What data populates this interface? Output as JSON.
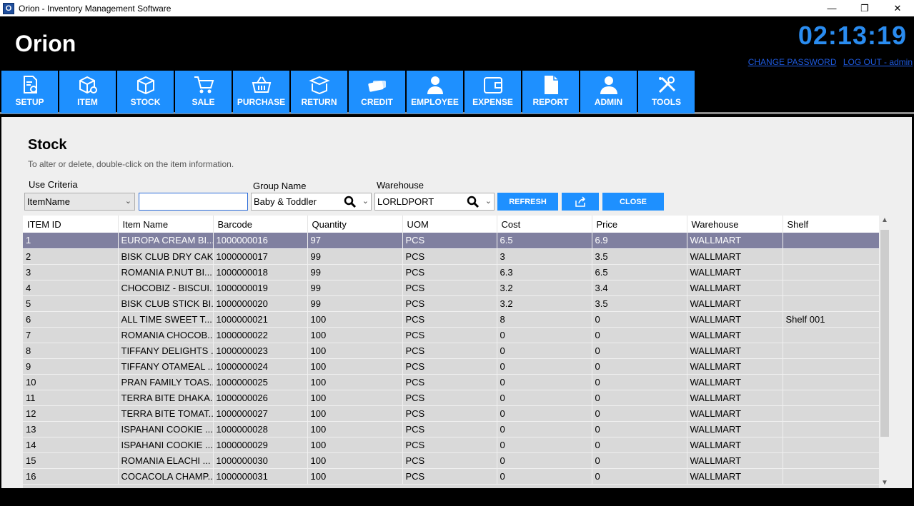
{
  "window": {
    "title": "Orion - Inventory Management Software",
    "app_icon": "O",
    "minimize": "—",
    "restore": "❐",
    "close": "✕"
  },
  "header": {
    "brand": "Orion",
    "clock": "02:13:19",
    "change_password": "CHANGE PASSWORD",
    "logout": "LOG OUT - admin",
    "clock_color": "#2a8cf0"
  },
  "menu": [
    {
      "label": "SETUP",
      "icon": "settings-doc-icon"
    },
    {
      "label": "ITEM",
      "icon": "box-gear-icon"
    },
    {
      "label": "STOCK",
      "icon": "box-icon"
    },
    {
      "label": "SALE",
      "icon": "cart-icon"
    },
    {
      "label": "PURCHASE",
      "icon": "basket-icon"
    },
    {
      "label": "RETURN",
      "icon": "open-box-icon"
    },
    {
      "label": "CREDIT",
      "icon": "credit-card-icon"
    },
    {
      "label": "EMPLOYEE",
      "icon": "employee-icon"
    },
    {
      "label": "EXPENSE",
      "icon": "wallet-icon"
    },
    {
      "label": "REPORT",
      "icon": "document-icon"
    },
    {
      "label": "ADMIN",
      "icon": "user-icon"
    },
    {
      "label": "TOOLS",
      "icon": "tools-icon"
    }
  ],
  "page": {
    "title": "Stock",
    "hint": "To alter or delete, double-click on the item information."
  },
  "filters": {
    "criteria_label": "Use Criteria",
    "criteria_value": "ItemName",
    "search_value": "",
    "group_label": "Group Name",
    "group_value": "Baby & Toddler",
    "warehouse_label": "Warehouse",
    "warehouse_value": "LORLDPORT"
  },
  "actions": {
    "refresh": "REFRESH",
    "export_icon": "share-icon",
    "close": "CLOSE"
  },
  "table": {
    "columns": [
      "ITEM ID",
      "Item Name",
      "Barcode",
      "Quantity",
      "UOM",
      "Cost",
      "Price",
      "Warehouse",
      "Shelf"
    ],
    "rows": [
      [
        "1",
        "EUROPA CREAM BI...",
        "1000000016",
        "97",
        "PCS",
        "6.5",
        "6.9",
        "WALLMART",
        ""
      ],
      [
        "2",
        "BISK CLUB DRY CAK...",
        "1000000017",
        "99",
        "PCS",
        "3",
        "3.5",
        "WALLMART",
        ""
      ],
      [
        "3",
        "ROMANIA P.NUT BI...",
        "1000000018",
        "99",
        "PCS",
        "6.3",
        "6.5",
        "WALLMART",
        ""
      ],
      [
        "4",
        "CHOCOBIZ - BISCUI...",
        "1000000019",
        "99",
        "PCS",
        "3.2",
        "3.4",
        "WALLMART",
        ""
      ],
      [
        "5",
        "BISK CLUB STICK BI...",
        "1000000020",
        "99",
        "PCS",
        "3.2",
        "3.5",
        "WALLMART",
        ""
      ],
      [
        "6",
        "ALL TIME SWEET T...",
        "1000000021",
        "100",
        "PCS",
        "8",
        "0",
        "WALLMART",
        "Shelf 001"
      ],
      [
        "7",
        "ROMANIA CHOCOB...",
        "1000000022",
        "100",
        "PCS",
        "0",
        "0",
        "WALLMART",
        ""
      ],
      [
        "8",
        "TIFFANY DELIGHTS ...",
        "1000000023",
        "100",
        "PCS",
        "0",
        "0",
        "WALLMART",
        ""
      ],
      [
        "9",
        "TIFFANY OTAMEAL ...",
        "1000000024",
        "100",
        "PCS",
        "0",
        "0",
        "WALLMART",
        ""
      ],
      [
        "10",
        "PRAN FAMILY TOAS...",
        "1000000025",
        "100",
        "PCS",
        "0",
        "0",
        "WALLMART",
        ""
      ],
      [
        "11",
        "TERRA BITE DHAKA...",
        "1000000026",
        "100",
        "PCS",
        "0",
        "0",
        "WALLMART",
        ""
      ],
      [
        "12",
        "TERRA BITE TOMAT...",
        "1000000027",
        "100",
        "PCS",
        "0",
        "0",
        "WALLMART",
        ""
      ],
      [
        "13",
        "ISPAHANI COOKIE ...",
        "1000000028",
        "100",
        "PCS",
        "0",
        "0",
        "WALLMART",
        ""
      ],
      [
        "14",
        "ISPAHANI COOKIE ...",
        "1000000029",
        "100",
        "PCS",
        "0",
        "0",
        "WALLMART",
        ""
      ],
      [
        "15",
        "ROMANIA ELACHI ...",
        "1000000030",
        "100",
        "PCS",
        "0",
        "0",
        "WALLMART",
        ""
      ],
      [
        "16",
        "COCACOLA CHAMP...",
        "1000000031",
        "100",
        "PCS",
        "0",
        "0",
        "WALLMART",
        ""
      ]
    ]
  },
  "colors": {
    "menu_button": "#1e90ff",
    "selected_row": "#8080a0",
    "link": "#1e5adf"
  }
}
